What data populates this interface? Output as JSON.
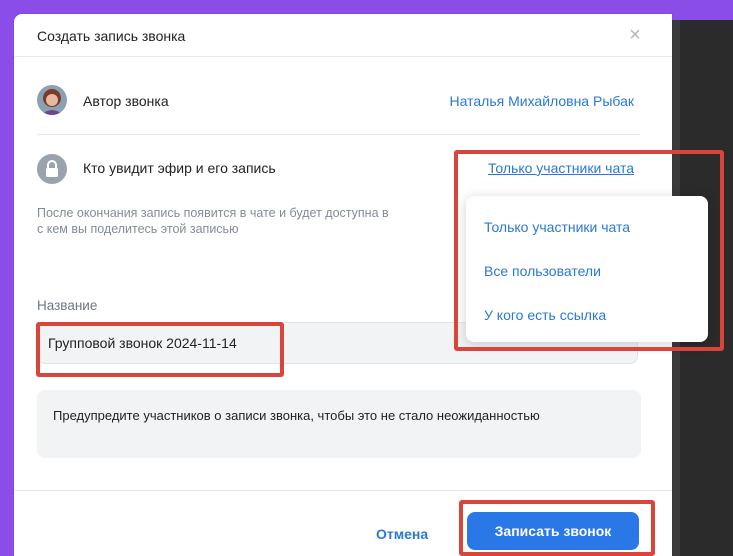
{
  "dialog": {
    "title": "Создать запись звонка",
    "close_label": "×",
    "author": {
      "label": "Автор звонка",
      "name": "Наталья Михайловна Рыбак"
    },
    "visibility": {
      "label": "Кто увидит эфир и его запись",
      "value": "Только участники чата",
      "hint": "После окончания запись появится в чате и будет доступна в",
      "hint_line2": "с кем вы поделитесь этой записью"
    },
    "name_field": {
      "label": "Название",
      "value": "Групповой звонок 2024-11-14"
    },
    "warning": "Предупредите участников о записи звонка, чтобы это не стало неожиданностью",
    "buttons": {
      "cancel": "Отмена",
      "record": "Записать звонок"
    }
  },
  "visibility_dropdown": {
    "options": [
      "Только участники чата",
      "Все пользователи",
      "У кого есть ссылка"
    ]
  },
  "colors": {
    "accent": "#2a78e8",
    "link": "#2a78d8",
    "highlight": "#d9453b",
    "backdrop": "#8a4de8"
  }
}
